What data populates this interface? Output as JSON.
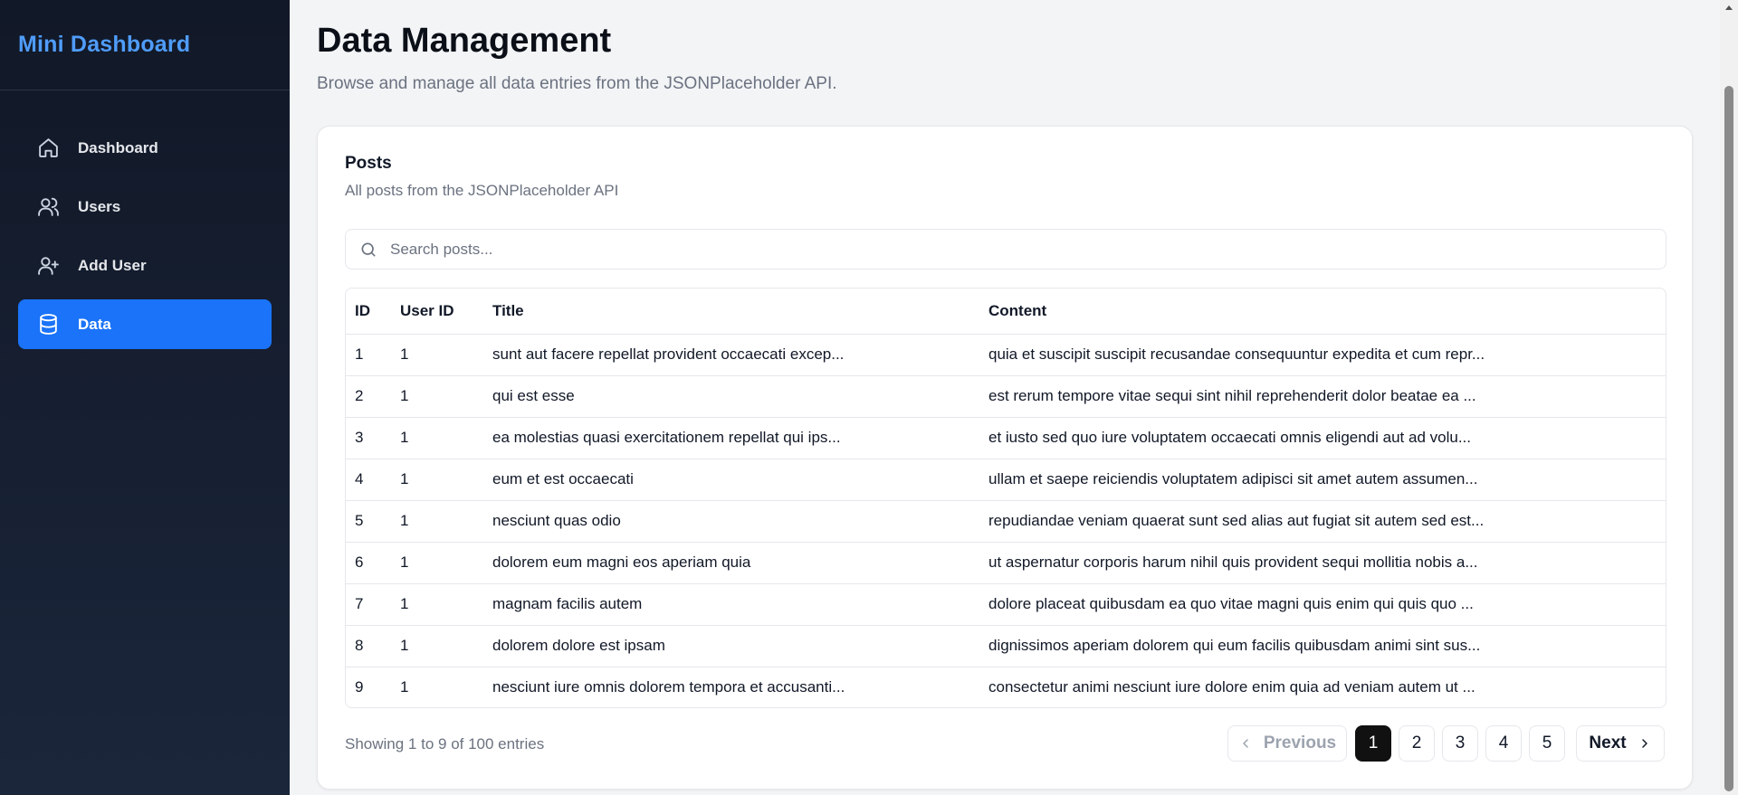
{
  "sidebar": {
    "brand": "Mini Dashboard",
    "items": [
      {
        "label": "Dashboard",
        "icon": "home-icon",
        "active": false
      },
      {
        "label": "Users",
        "icon": "users-icon",
        "active": false
      },
      {
        "label": "Add User",
        "icon": "user-plus-icon",
        "active": false
      },
      {
        "label": "Data",
        "icon": "database-icon",
        "active": true
      }
    ]
  },
  "main": {
    "title": "Data Management",
    "subtitle": "Browse and manage all data entries from the JSONPlaceholder API."
  },
  "card": {
    "title": "Posts",
    "subtitle": "All posts from the JSONPlaceholder API",
    "search": {
      "placeholder": "Search posts...",
      "value": "",
      "icon": "search-icon"
    }
  },
  "table": {
    "columns": [
      "ID",
      "User ID",
      "Title",
      "Content"
    ],
    "rows": [
      [
        "1",
        "1",
        "sunt aut facere repellat provident occaecati excep...",
        "quia et suscipit suscipit recusandae consequuntur expedita et cum repr..."
      ],
      [
        "2",
        "1",
        "qui est esse",
        "est rerum tempore vitae sequi sint nihil reprehenderit dolor beatae ea ..."
      ],
      [
        "3",
        "1",
        "ea molestias quasi exercitationem repellat qui ips...",
        "et iusto sed quo iure voluptatem occaecati omnis eligendi aut ad volu..."
      ],
      [
        "4",
        "1",
        "eum et est occaecati",
        "ullam et saepe reiciendis voluptatem adipisci sit amet autem assumen..."
      ],
      [
        "5",
        "1",
        "nesciunt quas odio",
        "repudiandae veniam quaerat sunt sed alias aut fugiat sit autem sed est..."
      ],
      [
        "6",
        "1",
        "dolorem eum magni eos aperiam quia",
        "ut aspernatur corporis harum nihil quis provident sequi mollitia nobis a..."
      ],
      [
        "7",
        "1",
        "magnam facilis autem",
        "dolore placeat quibusdam ea quo vitae magni quis enim qui quis quo ..."
      ],
      [
        "8",
        "1",
        "dolorem dolore est ipsam",
        "dignissimos aperiam dolorem qui eum facilis quibusdam animi sint sus..."
      ],
      [
        "9",
        "1",
        "nesciunt iure omnis dolorem tempora et accusanti...",
        "consectetur animi nesciunt iure dolore enim quia ad veniam autem ut ..."
      ]
    ]
  },
  "footer": {
    "info": "Showing 1 to 9 of 100 entries",
    "pagination": {
      "previous": "Previous",
      "next": "Next",
      "pages": [
        "1",
        "2",
        "3",
        "4",
        "5"
      ],
      "current": "1"
    }
  },
  "colors": {
    "brand": "#4f9cf9",
    "active_nav": "#1a73f8",
    "sidebar_bg": "#111827",
    "active_page": "#111111"
  }
}
